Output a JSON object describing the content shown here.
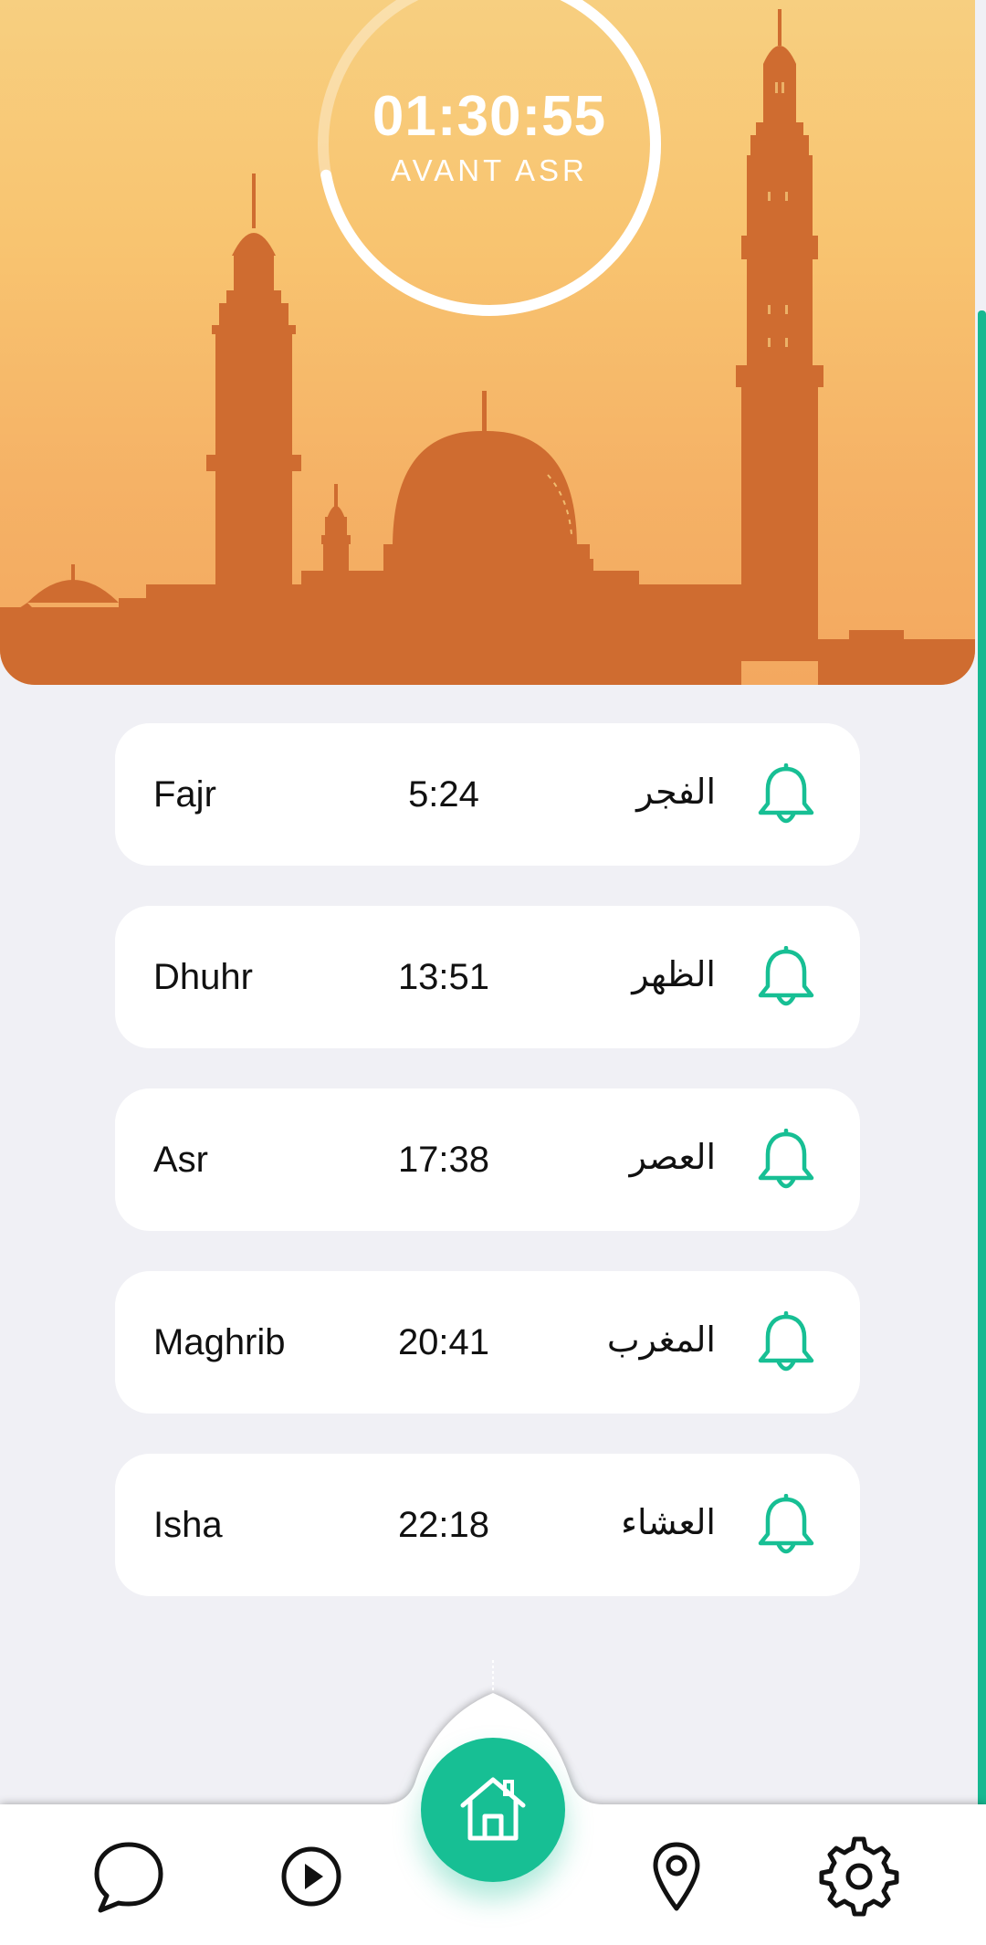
{
  "countdown": {
    "time": "01:30:55",
    "label": "AVANT ASR",
    "progress": 0.72
  },
  "prayers": [
    {
      "name": "Fajr",
      "time": "5:24",
      "arabic": "الفجر"
    },
    {
      "name": "Dhuhr",
      "time": "13:51",
      "arabic": "الظهر"
    },
    {
      "name": "Asr",
      "time": "17:38",
      "arabic": "العصر"
    },
    {
      "name": "Maghrib",
      "time": "20:41",
      "arabic": "المغرب"
    },
    {
      "name": "Isha",
      "time": "22:18",
      "arabic": "العشاء"
    }
  ],
  "nav": {
    "items": [
      "chat-icon",
      "play-icon",
      "home-icon",
      "location-icon",
      "settings-icon"
    ],
    "active": "home-icon"
  },
  "colors": {
    "accent": "#17bf94",
    "mosque": "#cf6c30",
    "sky_top": "#f7cf80",
    "sky_bottom": "#f3a85f",
    "background": "#f0f0f5"
  },
  "icons": {
    "bell": "bell-icon"
  }
}
